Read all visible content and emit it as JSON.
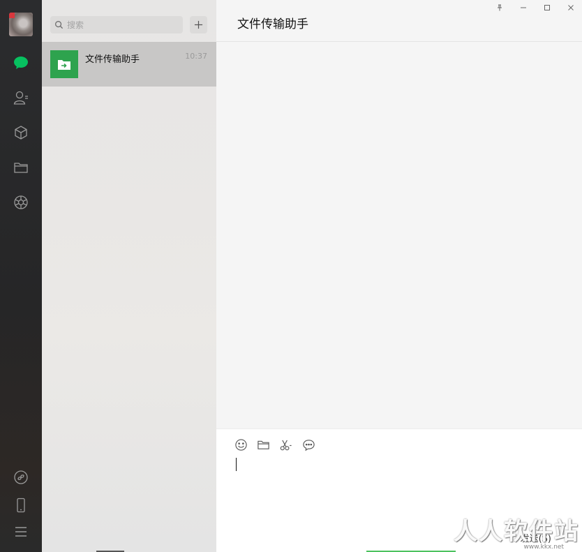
{
  "sidebar": {
    "icons": [
      "chat-icon",
      "contacts-icon",
      "cube-icon",
      "folder-icon",
      "moments-icon",
      "mini-program-icon",
      "phone-icon",
      "menu-icon"
    ],
    "accent_color": "#07c160"
  },
  "search": {
    "placeholder": "搜索"
  },
  "sessions": [
    {
      "name": "文件传输助手",
      "time": "10:37"
    }
  ],
  "chat": {
    "title": "文件传输助手",
    "send_label": "发送(S)"
  },
  "watermark": {
    "text": "人人软件站",
    "url": "www.kkx.net"
  }
}
